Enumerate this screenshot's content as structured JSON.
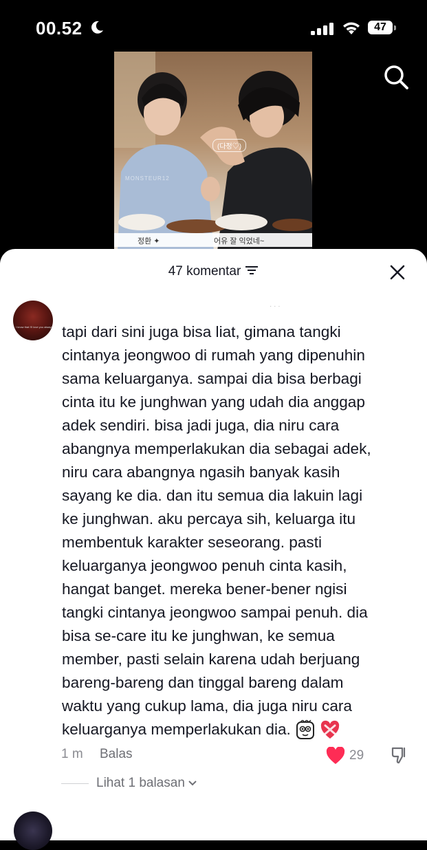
{
  "status_bar": {
    "time": "00.52",
    "battery": "47"
  },
  "video": {
    "bubble_text": "(다정♡)",
    "watermark": "MONSTEUR12",
    "caption_left": "정환 ✦",
    "caption_right": "어유 잘 익었네~"
  },
  "comments_header": {
    "title": "47 komentar"
  },
  "comment": {
    "avatar_text": "I know that I'll love you always",
    "lines": [
      "tapi dari sini juga bisa liat, gimana tangki",
      "cintanya jeongwoo di rumah yang dipenuhin",
      "sama keluarganya. sampai dia bisa berbagi",
      "cinta itu ke junghwan yang udah dia anggap",
      "adek sendiri. bisa jadi juga, dia niru cara",
      "abangnya memperlakukan dia sebagai adek,",
      "niru cara abangnya ngasih banyak kasih",
      "sayang ke dia. dan itu semua dia lakuin lagi",
      "ke junghwan. aku percaya sih, keluarga itu",
      "membentuk karakter seseorang. pasti",
      "keluarganya jeongwoo penuh cinta kasih,",
      "hangat banget. mereka bener-bener ngisi",
      "tangki cintanya jeongwoo sampai penuh. dia",
      "bisa se-care itu ke junghwan, ke semua",
      "member, pasti selain karena udah berjuang",
      "bareng-bareng dan tinggal bareng dalam",
      "waktu yang cukup lama, dia juga niru cara",
      "keluarganya memperlakukan dia."
    ],
    "time": "1 m",
    "reply_label": "Balas",
    "likes": "29",
    "view_replies": "Lihat 1 balasan"
  }
}
